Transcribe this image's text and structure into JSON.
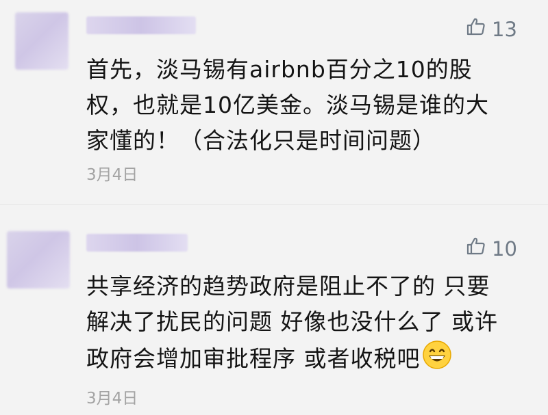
{
  "comments": [
    {
      "likes": "13",
      "text_lines": [
        "首先，淡马锡有airbnb百分之10的股",
        "权，也就是10亿美金。淡马锡是谁的大",
        "家懂的！（合法化只是时间问题）"
      ],
      "date": "3月4日"
    },
    {
      "likes": "10",
      "text_lines": [
        "共享经济的趋势政府是阻止不了的 只要",
        "解决了扰民的问题 好像也没什么了 或许",
        "政府会增加审批程序 或者收税吧"
      ],
      "emoji": "grinning-face-emoji",
      "date": "3月4日"
    }
  ],
  "colors": {
    "background": "#f3f3f3",
    "text": "#141414",
    "like_icon": "#6f7a86",
    "date": "#a3a3a3"
  }
}
